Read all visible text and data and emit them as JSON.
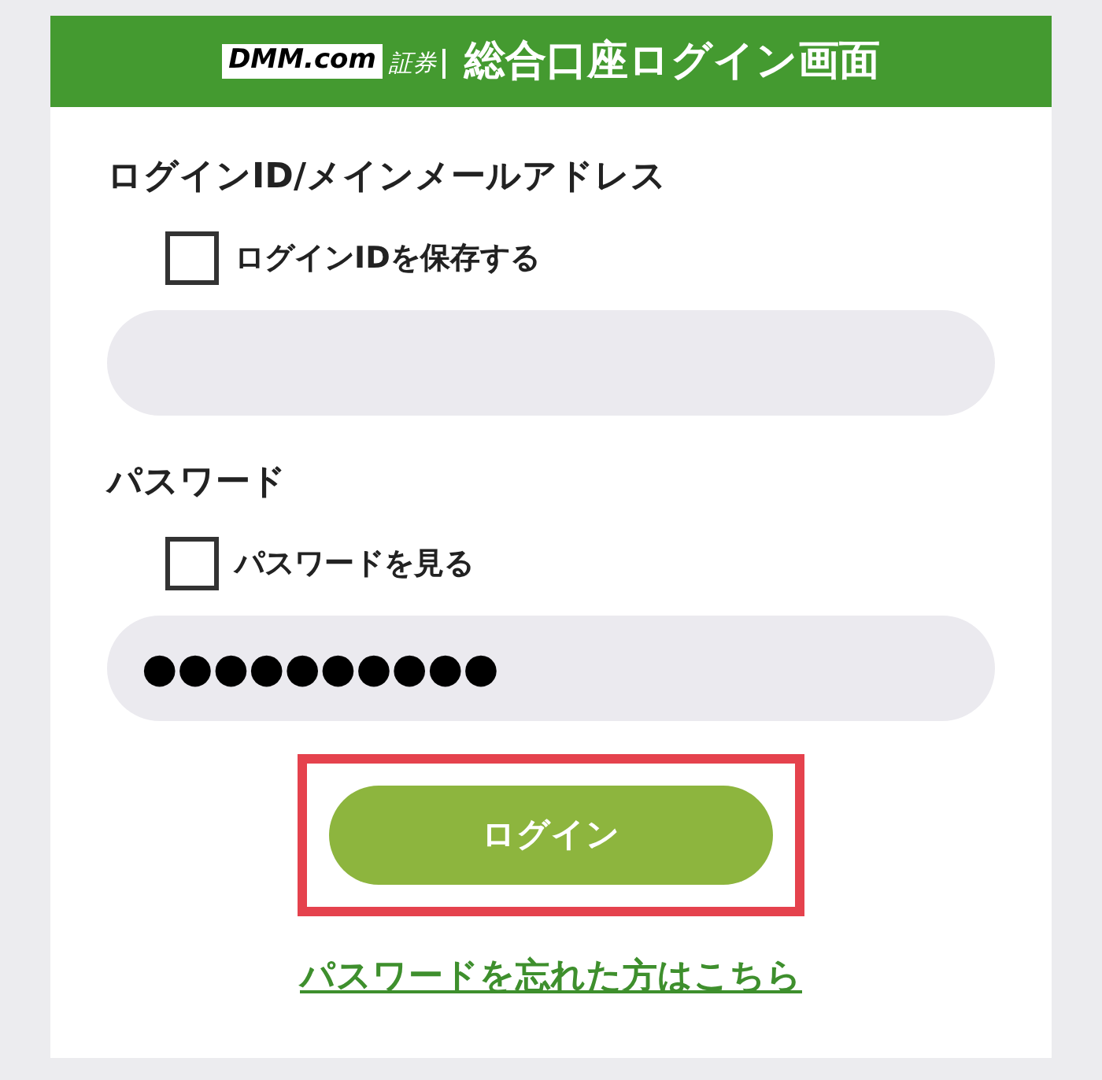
{
  "header": {
    "logo_main": "DMM.com",
    "logo_sub": "証券",
    "title": "総合口座ログイン画面"
  },
  "fields": [
    {
      "label": "ログインID/メインメールアドレス",
      "checkbox": {
        "label": "ログインIDを保存する",
        "checked": false
      }
    },
    {
      "label": "パスワード",
      "checkbox": {
        "label": "パスワードを見る",
        "checked": false
      },
      "value": "●●●●●●●●●●"
    }
  ],
  "login_button": {
    "label": "ログイン",
    "highlighted": true
  },
  "forgot_link": "パスワードを忘れた方はこちら"
}
